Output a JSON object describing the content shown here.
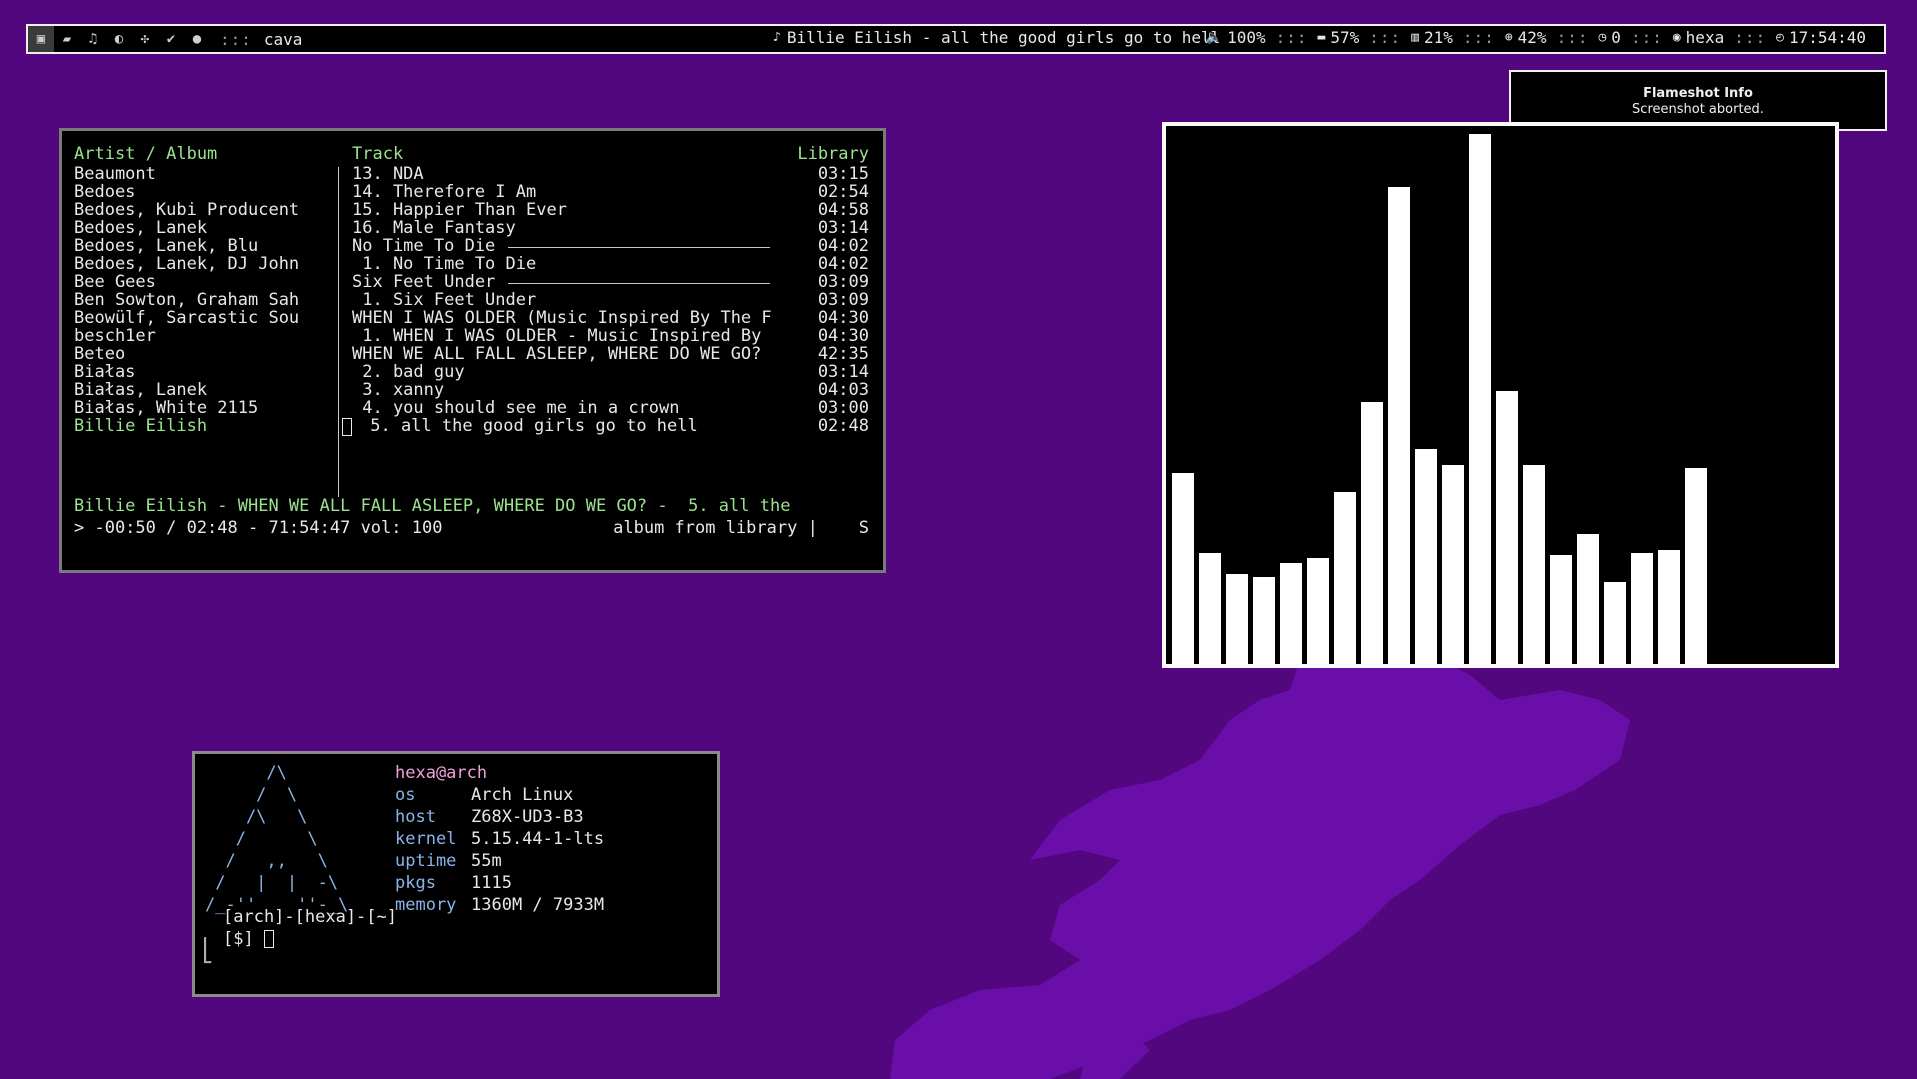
{
  "topbar": {
    "workspace_icons": [
      "terminal-icon",
      "chat-icon",
      "music-icon",
      "moon-icon",
      "puzzle-icon",
      "check-icon",
      "globe-icon"
    ],
    "separator": ":::",
    "window_title": "cava",
    "now_playing": "Billie Eilish - all the good girls go to hell",
    "volume": "100%",
    "disk": "57%",
    "memory": "21%",
    "cpu": "42%",
    "pending": "0",
    "user": "hexa",
    "clock": "17:54:40"
  },
  "notification": {
    "title": "Flameshot Info",
    "body": "Screenshot aborted."
  },
  "cmus": {
    "header_left": "Artist / Album",
    "header_mid": "Track",
    "header_right": "Library",
    "artists": [
      "Beaumont",
      "Bedoes",
      "Bedoes, Kubi Producent",
      "Bedoes, Lanek",
      "Bedoes, Lanek, Blu",
      "Bedoes, Lanek, DJ John",
      "Bee Gees",
      "Ben Sowton, Graham Sah",
      "Beowülf, Sarcastic Sou",
      "besch1er",
      "Beteo",
      "Białas",
      "Białas, Lanek",
      "Białas, White 2115",
      "Billie Eilish"
    ],
    "tracks": [
      {
        "title": "13. NDA",
        "time": "03:15",
        "album": false
      },
      {
        "title": "14. Therefore I Am",
        "time": "02:54",
        "album": false
      },
      {
        "title": "15. Happier Than Ever",
        "time": "04:58",
        "album": false
      },
      {
        "title": "16. Male Fantasy",
        "time": "03:14",
        "album": false
      },
      {
        "title": "No Time To Die",
        "time": "04:02",
        "album": true
      },
      {
        "title": " 1. No Time To Die",
        "time": "04:02",
        "album": false
      },
      {
        "title": "Six Feet Under",
        "time": "03:09",
        "album": true
      },
      {
        "title": " 1. Six Feet Under",
        "time": "03:09",
        "album": false
      },
      {
        "title": "WHEN I WAS OLDER (Music Inspired By The F",
        "time": "04:30",
        "album": false
      },
      {
        "title": " 1. WHEN I WAS OLDER - Music Inspired By",
        "time": "04:30",
        "album": false
      },
      {
        "title": "WHEN WE ALL FALL ASLEEP, WHERE DO WE GO?",
        "time": "42:35",
        "album": false
      },
      {
        "title": " 2. bad guy",
        "time": "03:14",
        "album": false
      },
      {
        "title": " 3. xanny",
        "time": "04:03",
        "album": false
      },
      {
        "title": " 4. you should see me in a crown",
        "time": "03:00",
        "album": false
      },
      {
        "title": " 5. all the good girls go to hell",
        "time": "02:48",
        "album": false
      }
    ],
    "now_playing_line": "Billie Eilish - WHEN WE ALL FALL ASLEEP, WHERE DO WE GO? -  5. all the",
    "status_left": "> -00:50 / 02:48 - 71:54:47 vol: 100",
    "status_right": "album from library |    S"
  },
  "cava": {
    "chart_data": {
      "type": "bar",
      "values": [
        0.36,
        0.21,
        0.17,
        0.165,
        0.19,
        0.2,
        0.325,
        0.495,
        0.9,
        0.405,
        0.375,
        1.0,
        0.515,
        0.375,
        0.205,
        0.245,
        0.155,
        0.21,
        0.215,
        0.37
      ],
      "ylim": [
        0,
        1
      ]
    }
  },
  "fetch": {
    "ascii_art": [
      "      /\\",
      "     /  \\",
      "    /\\   \\",
      "   /      \\",
      "  /   ,,   \\",
      " /   |  |  -\\",
      "/_-''    ''-_\\"
    ],
    "user_host": "hexa@arch",
    "rows": [
      {
        "key": "os",
        "value": "Arch Linux"
      },
      {
        "key": "host",
        "value": "Z68X-UD3-B3"
      },
      {
        "key": "kernel",
        "value": "5.15.44-1-lts"
      },
      {
        "key": "uptime",
        "value": "55m"
      },
      {
        "key": "pkgs",
        "value": "1115"
      },
      {
        "key": "memory",
        "value": "1360M / 7933M"
      }
    ],
    "prompt_line1": "[arch]-[hexa]-[~]",
    "prompt_line2": "[$]"
  },
  "colors": {
    "background": "#53077f",
    "map": "#6d0fb0",
    "cmus_green": "#9be38e",
    "fetch_blue": "#8ab4e8",
    "fetch_pink": "#f0a0d8"
  }
}
